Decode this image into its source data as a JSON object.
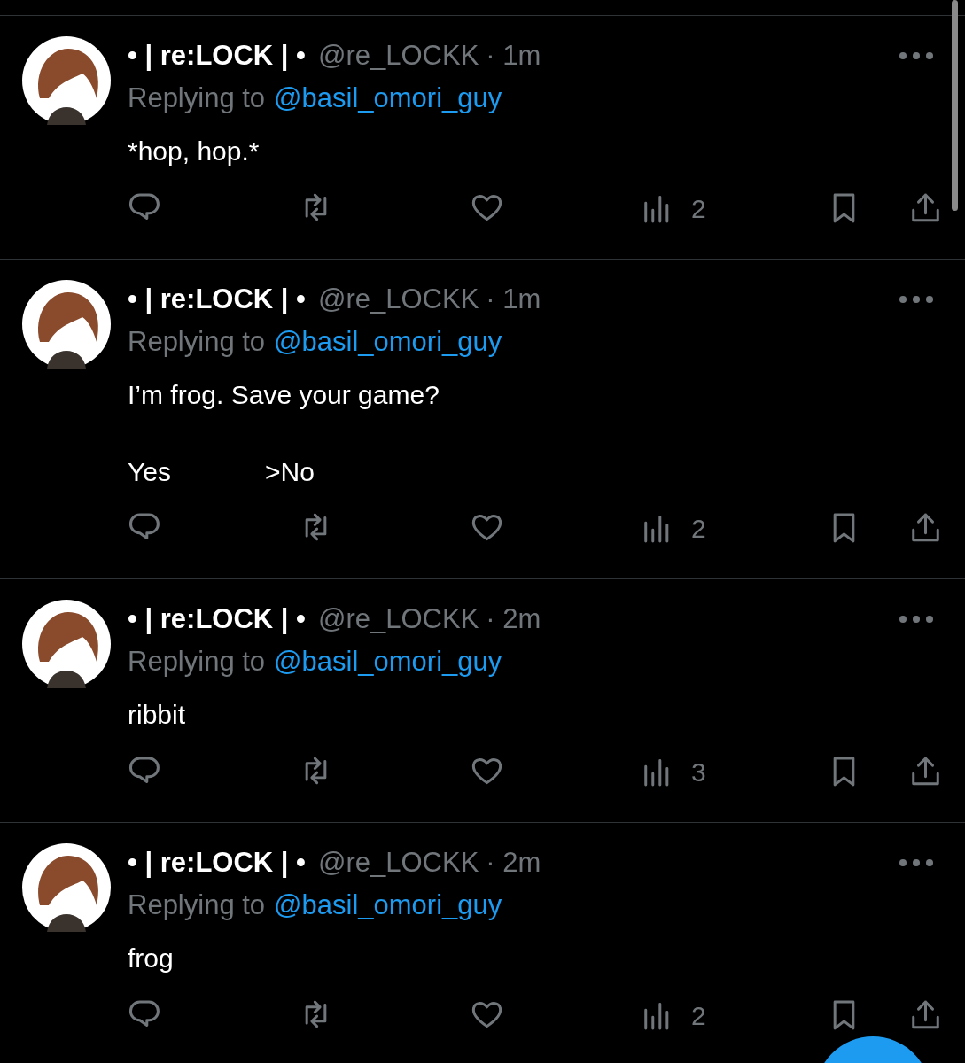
{
  "posts": [
    {
      "display_name": "• | re:LOCK | •",
      "handle": "@re_LOCKK",
      "time": "· 1m",
      "replying_label": "Replying to",
      "replying_to": "@basil_omori_guy",
      "text": "*hop, hop.*",
      "views": "2"
    },
    {
      "display_name": "• | re:LOCK | •",
      "handle": "@re_LOCKK",
      "time": "· 1m",
      "replying_label": "Replying to",
      "replying_to": "@basil_omori_guy",
      "text": "I’m frog. Save your game?",
      "options": [
        "Yes",
        ">No"
      ],
      "views": "2"
    },
    {
      "display_name": "• | re:LOCK | •",
      "handle": "@re_LOCKK",
      "time": "· 2m",
      "replying_label": "Replying to",
      "replying_to": "@basil_omori_guy",
      "text": "ribbit",
      "views": "3"
    },
    {
      "display_name": "• | re:LOCK | •",
      "handle": "@re_LOCKK",
      "time": "· 2m",
      "replying_label": "Replying to",
      "replying_to": "@basil_omori_guy",
      "text": "frog",
      "views": "2"
    }
  ]
}
